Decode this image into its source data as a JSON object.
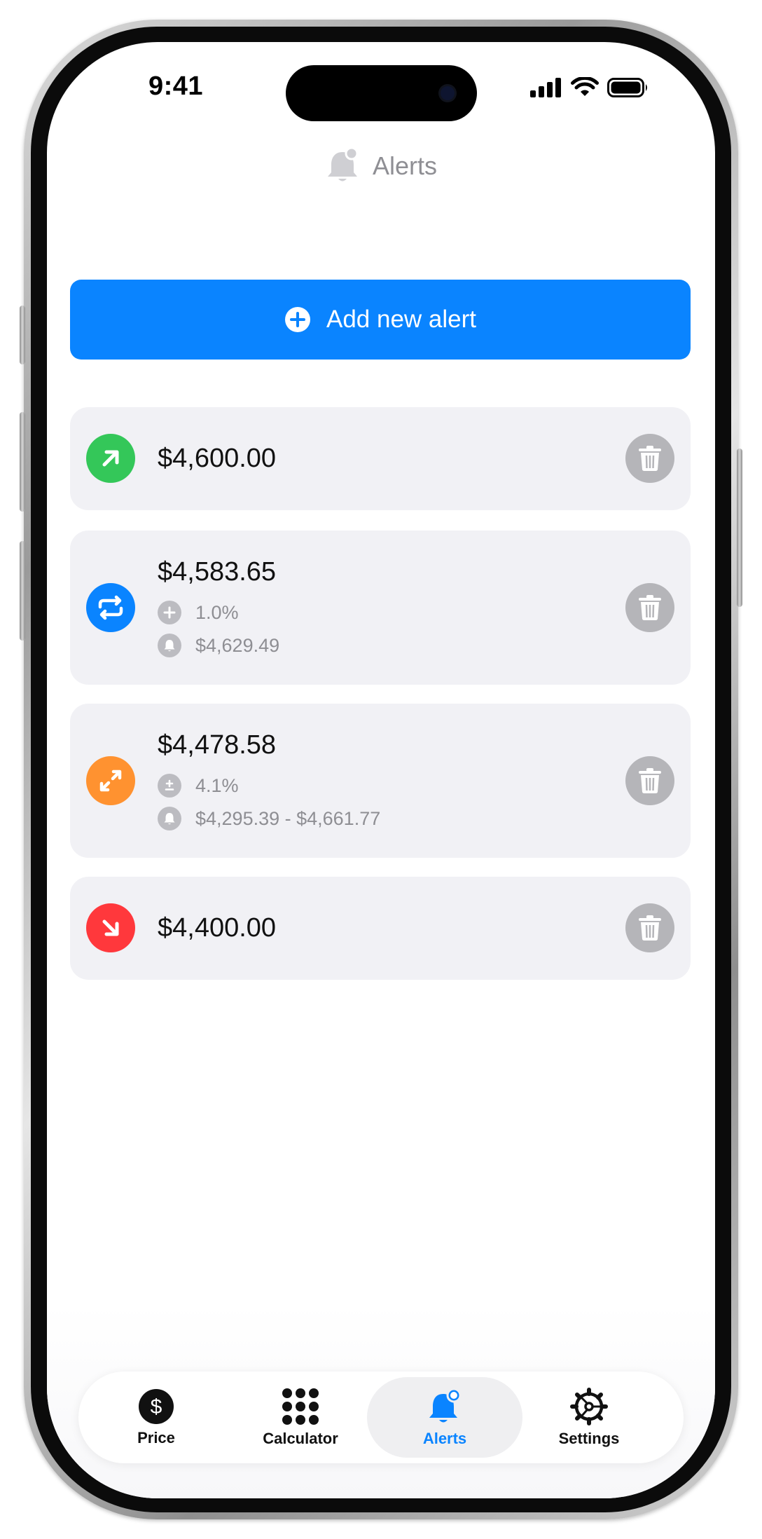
{
  "status_bar": {
    "time": "9:41"
  },
  "header": {
    "title": "Alerts",
    "icon": "bell-badge-icon"
  },
  "add_button": {
    "label": "Add new alert",
    "icon": "plus-circle-icon"
  },
  "alerts": [
    {
      "type": "above",
      "icon": "arrow-up-right-icon",
      "color": "#34c759",
      "price": "$4,600.00"
    },
    {
      "type": "percent-change",
      "icon": "repeat-icon",
      "color": "#0a84ff",
      "price": "$4,583.65",
      "details": [
        {
          "icon": "plus-circle-icon",
          "text": "1.0%"
        },
        {
          "icon": "bell-icon",
          "text": "$4,629.49"
        }
      ]
    },
    {
      "type": "range",
      "icon": "expand-icon",
      "color": "#ff9230",
      "price": "$4,478.58",
      "details": [
        {
          "icon": "plus-minus-icon",
          "text": "4.1%"
        },
        {
          "icon": "bell-icon",
          "text": "$4,295.39 - $4,661.77"
        }
      ]
    },
    {
      "type": "below",
      "icon": "arrow-down-right-icon",
      "color": "#ff383c",
      "price": "$4,400.00"
    }
  ],
  "tabs": [
    {
      "label": "Price",
      "icon": "dollar-circle-icon",
      "active": false
    },
    {
      "label": "Calculator",
      "icon": "grid-dots-icon",
      "active": false
    },
    {
      "label": "Alerts",
      "icon": "bell-badge-icon",
      "active": true
    },
    {
      "label": "Settings",
      "icon": "gear-icon",
      "active": false
    }
  ],
  "colors": {
    "accent": "#0a84ff",
    "card_bg": "#f1f1f5",
    "muted": "#8e8e93"
  }
}
